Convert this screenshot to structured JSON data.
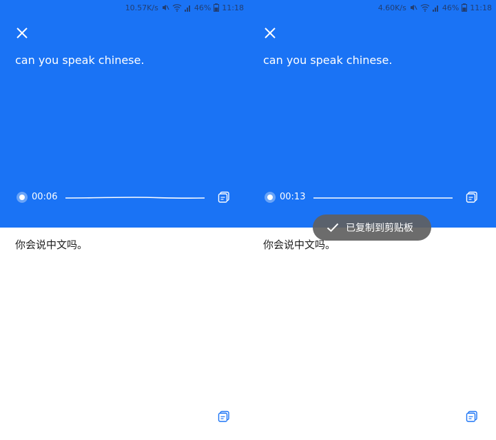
{
  "screens": [
    {
      "status": {
        "net_speed": "10.57K/s",
        "battery": "46%",
        "time": "11:18"
      },
      "source_text": "can you speak chinese.",
      "player": {
        "time": "00:06"
      },
      "target_text": "你会说中文吗。"
    },
    {
      "status": {
        "net_speed": "4.60K/s",
        "battery": "46%",
        "time": "11:18"
      },
      "source_text": "can you speak chinese.",
      "player": {
        "time": "00:13"
      },
      "target_text": "你会说中文吗。",
      "toast": "已复制到剪贴板"
    }
  ],
  "colors": {
    "primary_blue": "#1a73f5",
    "toast_bg": "#5f5f5f",
    "white": "#ffffff",
    "text_dark": "#1c1c1c"
  },
  "icons": [
    "close-icon",
    "play-indicator-icon",
    "copy-icon",
    "checkmark-icon",
    "signal-icon",
    "wifi-icon",
    "battery-icon",
    "mute-icon"
  ]
}
